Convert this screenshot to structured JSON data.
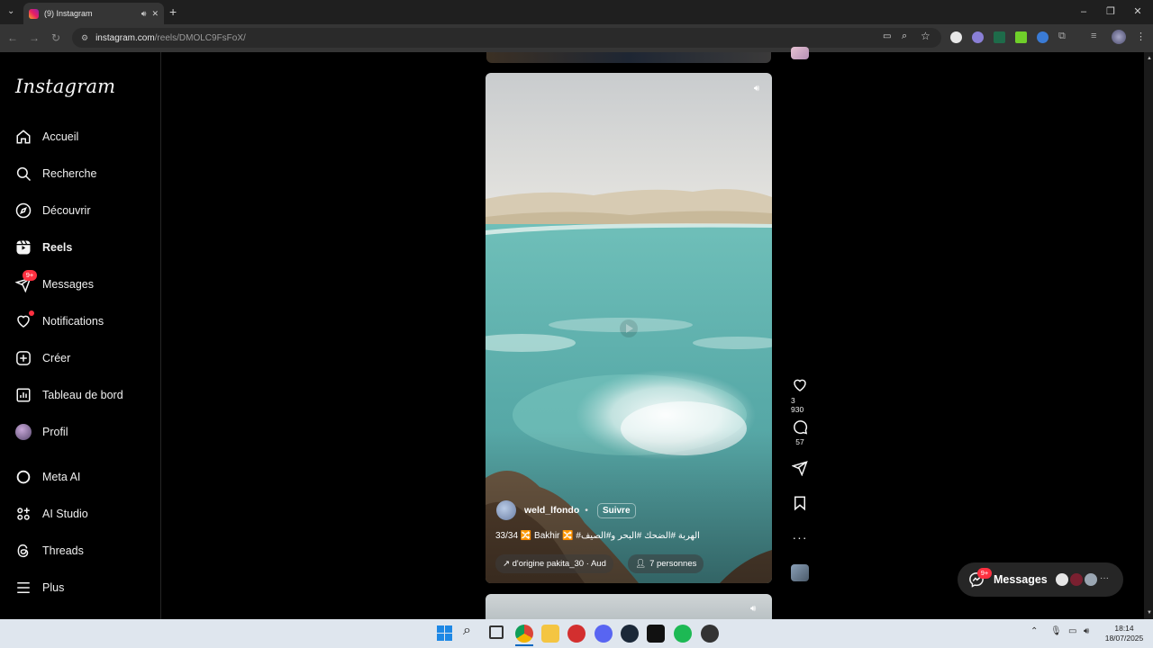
{
  "browser": {
    "tab_title": "(9) Instagram",
    "url_host": "instagram.com",
    "url_path": "/reels/DMOLC9FsFoX/"
  },
  "sidebar": {
    "logo": "Instagram",
    "items": [
      {
        "label": "Accueil",
        "icon": "home-icon"
      },
      {
        "label": "Recherche",
        "icon": "search-icon"
      },
      {
        "label": "Découvrir",
        "icon": "compass-icon"
      },
      {
        "label": "Reels",
        "icon": "reels-icon",
        "active": true
      },
      {
        "label": "Messages",
        "icon": "messenger-icon",
        "badge": "9+"
      },
      {
        "label": "Notifications",
        "icon": "heart-icon",
        "dot": true
      },
      {
        "label": "Créer",
        "icon": "plus-square-icon"
      },
      {
        "label": "Tableau de bord",
        "icon": "dashboard-icon"
      },
      {
        "label": "Profil",
        "icon": "avatar"
      },
      {
        "label": "Meta AI",
        "icon": "meta-ai-icon"
      },
      {
        "label": "AI Studio",
        "icon": "ai-studio-icon"
      },
      {
        "label": "Threads",
        "icon": "threads-icon"
      },
      {
        "label": "Plus",
        "icon": "menu-icon"
      }
    ]
  },
  "reel": {
    "author": "weld_lfondo",
    "separator": "•",
    "follow_label": "Suivre",
    "caption": "33/34 🔀 Bakhir 🔀 #الهربة #الضحك #البحر و#الصيف",
    "audio_label": "↗ d'origine  pakita_30 · Aud",
    "people_label": "7 personnes",
    "likes": "3 930",
    "comments": "57"
  },
  "messages_pill": {
    "label": "Messages",
    "badge": "9+"
  },
  "taskbar": {
    "time": "18:14",
    "date": "18/07/2025"
  },
  "colors": {
    "accent_red": "#ff3040",
    "background": "#000000",
    "surface": "#262626"
  }
}
